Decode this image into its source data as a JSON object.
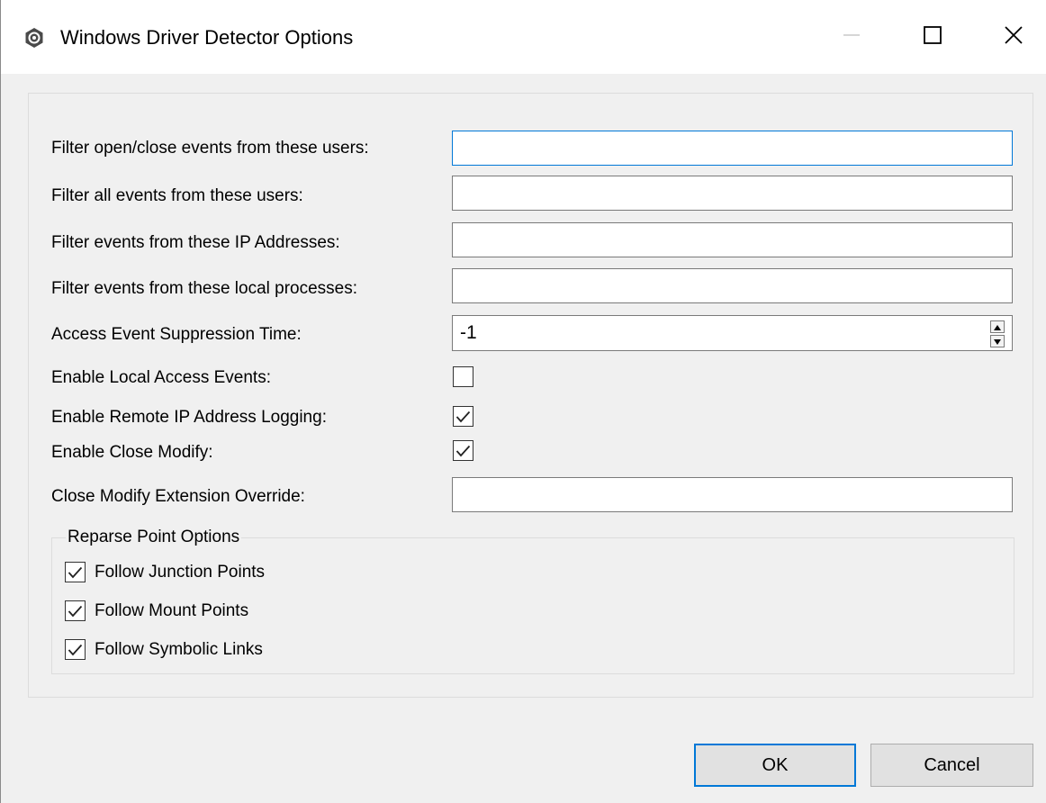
{
  "window": {
    "title": "Windows Driver Detector Options",
    "icon": "gear-logo-icon",
    "controls": {
      "minimize": "minimize-icon",
      "maximize": "maximize-icon",
      "close": "close-icon"
    }
  },
  "form": {
    "filter_open_close_users": {
      "label": "Filter open/close events from these users:",
      "value": ""
    },
    "filter_all_users": {
      "label": "Filter all events from these users:",
      "value": ""
    },
    "filter_ip_addresses": {
      "label": "Filter events from these IP Addresses:",
      "value": ""
    },
    "filter_local_processes": {
      "label": "Filter events from these local processes:",
      "value": ""
    },
    "suppression_time": {
      "label": "Access Event Suppression Time:",
      "value": "-1"
    },
    "enable_local_access": {
      "label": "Enable Local Access Events:",
      "checked": false
    },
    "enable_remote_ip_logging": {
      "label": "Enable Remote IP Address Logging:",
      "checked": true
    },
    "enable_close_modify": {
      "label": "Enable Close Modify:",
      "checked": true
    },
    "close_modify_override": {
      "label": "Close Modify Extension Override:",
      "value": ""
    }
  },
  "reparse": {
    "title": "Reparse Point Options",
    "options": [
      {
        "label": "Follow Junction Points",
        "checked": true
      },
      {
        "label": "Follow Mount Points",
        "checked": true
      },
      {
        "label": "Follow Symbolic Links",
        "checked": true
      }
    ]
  },
  "buttons": {
    "ok": "OK",
    "cancel": "Cancel"
  },
  "colors": {
    "accent": "#0078d7",
    "background": "#f0f0f0",
    "titlebar": "#ffffff"
  }
}
